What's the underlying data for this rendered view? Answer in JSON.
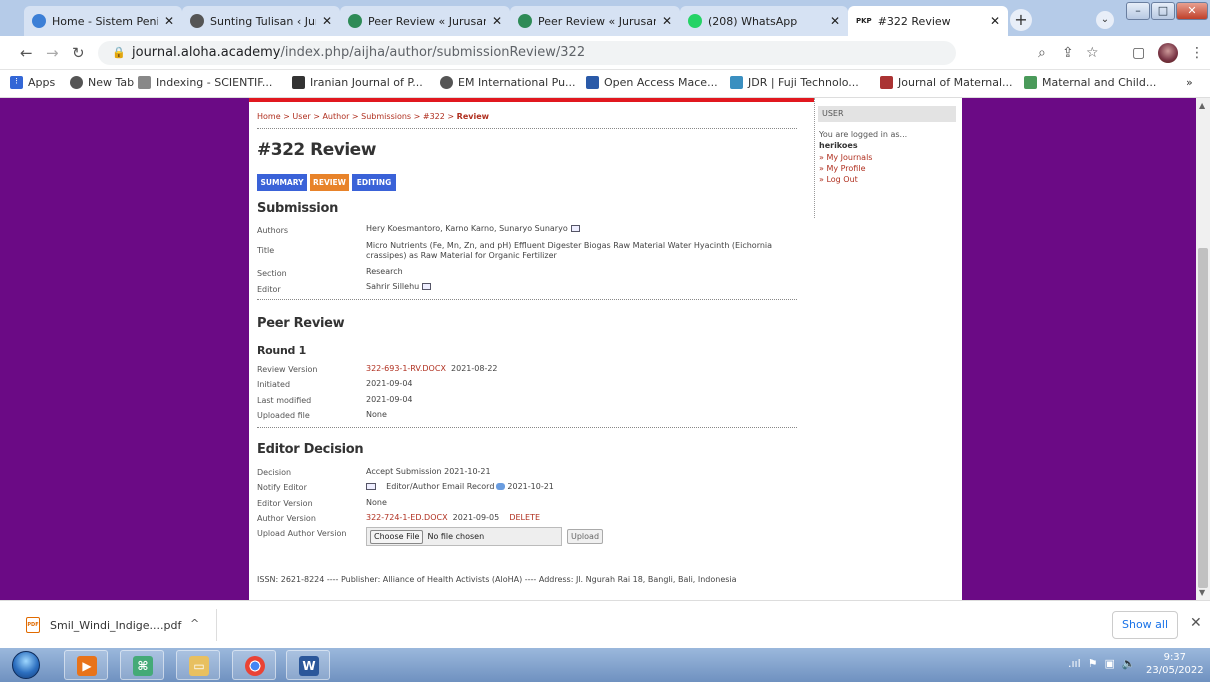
{
  "browser": {
    "tabs": [
      {
        "title": "Home - Sistem Penilaian",
        "icon": "globe-icon",
        "color": "#3c7fd6"
      },
      {
        "title": "Sunting Tulisan ‹ Jurusan",
        "icon": "globe-icon",
        "color": "#555555"
      },
      {
        "title": "Peer Review « Jurusan I",
        "icon": "burst-icon",
        "color": "#2e8b57"
      },
      {
        "title": "Peer Review « Jurusan I",
        "icon": "burst-icon",
        "color": "#2e8b57"
      },
      {
        "title": "(208) WhatsApp",
        "icon": "whatsapp-icon",
        "color": "#25d366"
      },
      {
        "title": "#322 Review",
        "prefix": "PKP",
        "icon": "pkp-icon",
        "color": "#333333"
      }
    ],
    "url_domain": "journal.aloha.academy",
    "url_path": "/index.php/aijha/author/submissionReview/322",
    "bookmarks": [
      {
        "label": "Apps",
        "icon": "apps-icon"
      },
      {
        "label": "New Tab",
        "icon": "globe-icon"
      },
      {
        "label": "Indexing - SCIENTIF...",
        "icon": "index-icon"
      },
      {
        "label": "Iranian Journal of P...",
        "icon": "journal-icon"
      },
      {
        "label": "EM International Pu...",
        "icon": "globe-icon"
      },
      {
        "label": "Open Access Mace...",
        "icon": "oamjms-icon"
      },
      {
        "label": "JDR | Fuji Technolo...",
        "icon": "jdr-icon"
      },
      {
        "label": "Journal of Maternal...",
        "icon": "jmch-icon"
      },
      {
        "label": "Maternal and Child...",
        "icon": "leaf-icon"
      }
    ],
    "bookmarks_more": "»"
  },
  "page": {
    "breadcrumb_links": "Home > User > Author > Submissions > #322 > ",
    "breadcrumb_current": "Review",
    "title": "#322 Review",
    "tabs": [
      {
        "label": "SUMMARY",
        "color": "#3a62d8"
      },
      {
        "label": "REVIEW",
        "color": "#e8832a"
      },
      {
        "label": "EDITING",
        "color": "#3a62d8"
      }
    ],
    "submission": {
      "heading": "Submission",
      "authors_label": "Authors",
      "authors": "Hery Koesmantoro, Karno Karno, Sunaryo Sunaryo",
      "title_label": "Title",
      "title_line1": "Micro Nutrients (Fe, Mn, Zn, and pH) Effluent Digester Biogas Raw Material Water Hyacinth (Eichornia",
      "title_line2": "crassipes) as Raw Material for Organic Fertilizer",
      "section_label": "Section",
      "section": "Research",
      "editor_label": "Editor",
      "editor": "Sahrir Sillehu"
    },
    "peer_review": {
      "heading": "Peer Review",
      "round": "Round 1",
      "review_version_label": "Review Version",
      "review_version_file": "322-693-1-RV.DOCX",
      "review_version_date": "2021-08-22",
      "initiated_label": "Initiated",
      "initiated": "2021-09-04",
      "last_modified_label": "Last modified",
      "last_modified": "2021-09-04",
      "uploaded_file_label": "Uploaded file",
      "uploaded_file": "None"
    },
    "editor_decision": {
      "heading": "Editor Decision",
      "decision_label": "Decision",
      "decision": "Accept Submission 2021-10-21",
      "notify_label": "Notify Editor",
      "notify_text": "Editor/Author Email Record",
      "notify_date": "2021-10-21",
      "editor_version_label": "Editor Version",
      "editor_version": "None",
      "author_version_label": "Author Version",
      "author_version_file": "322-724-1-ED.DOCX",
      "author_version_date": "2021-09-05",
      "delete_label": "DELETE",
      "upload_label": "Upload Author Version",
      "choose_file": "Choose File",
      "no_file": "No file chosen",
      "upload_button": "Upload"
    },
    "footer": "ISSN: 2621-8224 ---- Publisher: Alliance of Health Activists (AloHA) ---- Address: Jl. Ngurah Rai 18, Bangli, Bali, Indonesia"
  },
  "sidebar": {
    "block_title": "USER",
    "logged_in_as": "You are logged in as...",
    "username": "herikoes",
    "links": [
      "» My Journals",
      "» My Profile",
      "» Log Out"
    ]
  },
  "downloads": {
    "file": "Smil_Windi_Indige....pdf",
    "show_all": "Show all"
  },
  "taskbar": {
    "time": "9:37",
    "date": "23/05/2022"
  }
}
